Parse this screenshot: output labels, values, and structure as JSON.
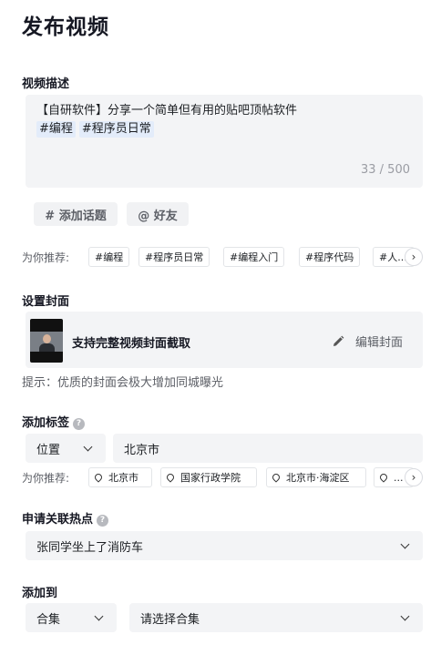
{
  "page_title": "发布视频",
  "description": {
    "label": "视频描述",
    "text": "【自研软件】分享一个简单但有用的贴吧顶帖软件",
    "tags": [
      "#编程",
      "#程序员日常"
    ],
    "count": "33 / 500"
  },
  "actions": {
    "add_topic": "# 添加话题",
    "friends": "@ 好友"
  },
  "recommend_topics": {
    "label": "为你推荐:",
    "items": [
      "#编程",
      "#程序员日常",
      "#编程入门",
      "#程序代码",
      "#人..."
    ]
  },
  "cover": {
    "label": "设置封面",
    "title": "支持完整视频封面截取",
    "edit_label": "编辑封面",
    "hint": "提示：优质的封面会极大增加同城曝光"
  },
  "tags_section": {
    "label": "添加标签",
    "type_value": "位置",
    "location_value": "北京市",
    "recommend_label": "为你推荐:",
    "locations": [
      "北京市",
      "国家行政学院",
      "北京市·海淀区",
      "..."
    ]
  },
  "hotspot": {
    "label": "申请关联热点",
    "value": "张同学坐上了消防车"
  },
  "add_to": {
    "label": "添加到",
    "type_value": "合集",
    "collection_placeholder": "请选择合集"
  }
}
